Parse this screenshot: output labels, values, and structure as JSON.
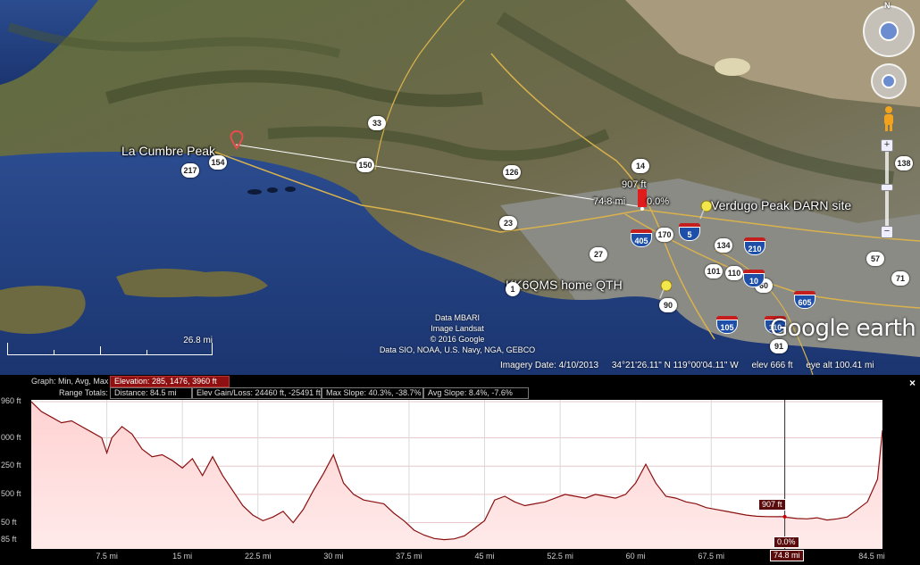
{
  "map": {
    "labels": {
      "la_cumbre": "La Cumbre Peak",
      "verdugo": "Verdugo Peak DARN site",
      "kk6qms": "KK6QMS home QTH"
    },
    "path_labels": {
      "height": "907 ft",
      "distance": "74.8 mi",
      "slope": "0.0%"
    },
    "route_shields": [
      "33",
      "154",
      "217",
      "150",
      "126",
      "14",
      "23",
      "27",
      "170",
      "134",
      "101",
      "110",
      "60",
      "90",
      "91",
      "57",
      "71",
      "138",
      "1"
    ],
    "interstate_shields": [
      "405",
      "5",
      "210",
      "10",
      "605",
      "105",
      "110"
    ],
    "credits": [
      "Data MBARI",
      "Image Landsat",
      "© 2016 Google",
      "Data SIO, NOAA, U.S. Navy, NGA, GEBCO"
    ],
    "scale": "26.8 mi",
    "logo": "Google earth",
    "compass": "N"
  },
  "status_bar": {
    "imagery_date": "Imagery Date: 4/10/2013",
    "coords": "34°21'26.11\" N  119°00'04.11\" W",
    "elev": "elev   666 ft",
    "eye_alt": "eye alt 100.41 mi"
  },
  "profile": {
    "graph_label": "Graph:",
    "graph_modes": "Min, Avg, Max",
    "elevation": "Elevation: 285, 1476, 3960 ft",
    "range_label": "Range Totals:",
    "distance": "Distance: 84.5 mi",
    "gain_loss": "Elev Gain/Loss: 24460 ft, -25491 ft",
    "max_slope": "Max Slope: 40.3%, -38.7%",
    "avg_slope": "Avg Slope: 8.4%, -7.6%",
    "close": "×",
    "cursor_elev": "907 ft",
    "cursor_slope": "0.0%",
    "cursor_dist": "74.8 mi"
  },
  "chart_data": {
    "type": "area",
    "x_unit": "mi",
    "y_unit": "ft",
    "ylim": [
      100,
      3960
    ],
    "xlim": [
      0,
      84.5
    ],
    "y_ticks": [
      "960 ft",
      "000 ft",
      "250 ft",
      "500 ft",
      "50 ft",
      "85 ft"
    ],
    "y_tick_values": [
      3960,
      3000,
      2250,
      1500,
      750,
      285
    ],
    "x_ticks": [
      "7.5 mi",
      "15 mi",
      "22.5 mi",
      "30 mi",
      "37.5 mi",
      "45 mi",
      "52.5 mi",
      "60 mi",
      "67.5 mi",
      "74.8 mi",
      "84.5 mi"
    ],
    "x_tick_values": [
      7.5,
      15,
      22.5,
      30,
      37.5,
      45,
      52.5,
      60,
      67.5,
      74.8,
      84.5
    ],
    "series": [
      {
        "x": [
          0,
          1,
          2,
          3,
          4,
          5,
          6,
          7,
          7.5,
          8,
          9,
          10,
          11,
          12,
          13,
          14,
          15,
          16,
          17,
          18,
          19,
          20,
          21,
          22,
          23,
          24,
          25,
          26,
          27,
          28,
          29,
          30,
          31,
          32,
          33,
          34,
          35,
          36,
          37,
          38,
          39,
          40,
          41,
          42,
          43,
          44,
          45,
          46,
          47,
          48,
          49,
          50,
          51,
          52,
          53,
          54,
          55,
          56,
          57,
          58,
          59,
          60,
          61,
          62,
          63,
          64,
          65,
          66,
          67,
          68,
          69,
          70,
          71,
          72,
          73,
          74,
          74.8,
          75,
          76,
          77,
          78,
          79,
          80,
          81,
          82,
          83,
          84,
          84.5
        ],
        "y": [
          3960,
          3700,
          3550,
          3400,
          3450,
          3300,
          3150,
          3000,
          2600,
          3000,
          3300,
          3100,
          2700,
          2500,
          2550,
          2400,
          2200,
          2450,
          2000,
          2500,
          2000,
          1600,
          1200,
          950,
          800,
          900,
          1050,
          750,
          1100,
          1600,
          2050,
          2550,
          1800,
          1500,
          1350,
          1300,
          1250,
          1000,
          800,
          550,
          420,
          330,
          300,
          320,
          400,
          600,
          800,
          1350,
          1450,
          1300,
          1200,
          1250,
          1300,
          1400,
          1500,
          1450,
          1400,
          1500,
          1450,
          1400,
          1500,
          1800,
          2300,
          1800,
          1450,
          1400,
          1300,
          1250,
          1150,
          1100,
          1050,
          1000,
          950,
          920,
          910,
          907,
          907,
          890,
          860,
          850,
          880,
          820,
          850,
          900,
          1100,
          1300,
          1900,
          3200
        ]
      }
    ]
  }
}
